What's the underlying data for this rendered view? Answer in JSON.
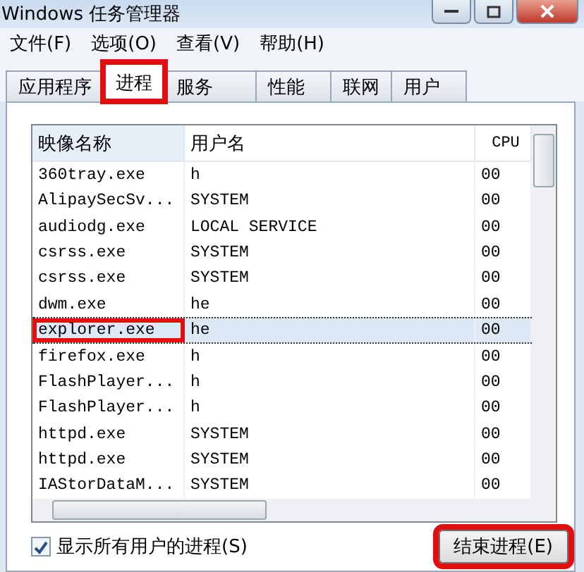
{
  "window": {
    "title": "Windows 任务管理器"
  },
  "menu": [
    "文件(F)",
    "选项(O)",
    "查看(V)",
    "帮助(H)"
  ],
  "tabs": [
    {
      "label": "应用程序",
      "selected": false,
      "highlighted": false
    },
    {
      "label": "进程",
      "selected": true,
      "highlighted": true
    },
    {
      "label": "服务",
      "selected": false,
      "highlighted": false
    },
    {
      "label": "性能",
      "selected": false,
      "highlighted": false
    },
    {
      "label": "联网",
      "selected": false,
      "highlighted": false
    },
    {
      "label": "用户",
      "selected": false,
      "highlighted": false
    }
  ],
  "table": {
    "columns": [
      "映像名称",
      "用户名",
      "CPU"
    ],
    "rows": [
      {
        "name": "360tray.exe",
        "user": "h",
        "cpu": "00",
        "selected": false,
        "highlighted": false
      },
      {
        "name": "AlipaySecSv...",
        "user": "SYSTEM",
        "cpu": "00",
        "selected": false,
        "highlighted": false
      },
      {
        "name": "audiodg.exe",
        "user": "LOCAL SERVICE",
        "cpu": "00",
        "selected": false,
        "highlighted": false
      },
      {
        "name": "csrss.exe",
        "user": "SYSTEM",
        "cpu": "00",
        "selected": false,
        "highlighted": false
      },
      {
        "name": "csrss.exe",
        "user": "SYSTEM",
        "cpu": "00",
        "selected": false,
        "highlighted": false
      },
      {
        "name": "dwm.exe",
        "user": "he",
        "cpu": "00",
        "selected": false,
        "highlighted": false
      },
      {
        "name": "explorer.exe",
        "user": "he",
        "cpu": "00",
        "selected": true,
        "highlighted": true
      },
      {
        "name": "firefox.exe",
        "user": "h",
        "cpu": "00",
        "selected": false,
        "highlighted": false
      },
      {
        "name": "FlashPlayer...",
        "user": "h",
        "cpu": "00",
        "selected": false,
        "highlighted": false
      },
      {
        "name": "FlashPlayer...",
        "user": "h",
        "cpu": "00",
        "selected": false,
        "highlighted": false
      },
      {
        "name": "httpd.exe",
        "user": "SYSTEM",
        "cpu": "00",
        "selected": false,
        "highlighted": false
      },
      {
        "name": "httpd.exe",
        "user": "SYSTEM",
        "cpu": "00",
        "selected": false,
        "highlighted": false
      },
      {
        "name": "IAStorDataM...",
        "user": "SYSTEM",
        "cpu": "00",
        "selected": false,
        "highlighted": false
      }
    ]
  },
  "show_all_users": {
    "label": "显示所有用户的进程(S)",
    "checked": true
  },
  "end_button": {
    "label": "结束进程(E)",
    "highlighted": true
  }
}
